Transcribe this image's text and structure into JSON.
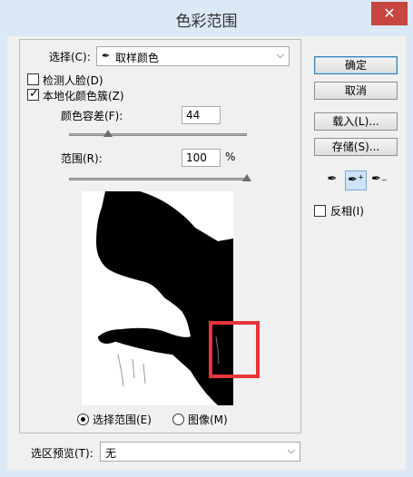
{
  "window": {
    "title": "色彩范围",
    "close_symbol": "✕"
  },
  "select_field": {
    "label": "选择(C):",
    "value": "取样颜色"
  },
  "detect_faces": {
    "label": "检测人脸(D)",
    "checked": false
  },
  "localized_clusters": {
    "label": "本地化颜色簇(Z)",
    "checked": true
  },
  "fuzziness": {
    "label": "颜色容差(F):",
    "value": "44",
    "fraction": 0.22
  },
  "range": {
    "label": "范围(R):",
    "value": "100",
    "unit": "%",
    "fraction": 1.0
  },
  "preview_mode": {
    "options": [
      {
        "label": "选择范围(E)",
        "selected": true
      },
      {
        "label": "图像(M)",
        "selected": false
      }
    ]
  },
  "selection_preview": {
    "label": "选区预览(T):",
    "value": "无"
  },
  "buttons": {
    "ok": "确定",
    "cancel": "取消",
    "load": "载入(L)...",
    "save": "存储(S)..."
  },
  "tools": [
    {
      "icon": "eyedropper-icon",
      "active": false
    },
    {
      "icon": "eyedropper-plus-icon",
      "active": true
    },
    {
      "icon": "eyedropper-minus-icon",
      "active": false
    }
  ],
  "invert": {
    "label": "反相(I)",
    "checked": false
  },
  "colors": {
    "highlight": "#e8333a",
    "accent": "#3c7fb1"
  }
}
